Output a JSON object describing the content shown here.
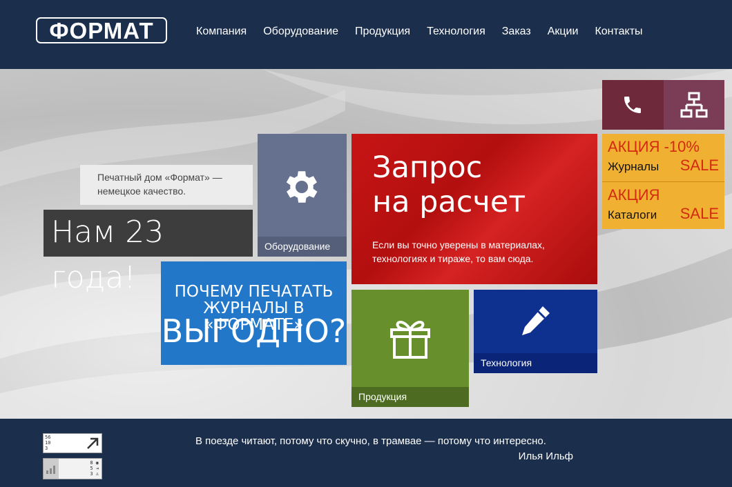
{
  "header": {
    "logo": "ФОРМАТ",
    "nav": [
      "Компания",
      "Оборудование",
      "Продукция",
      "Технология",
      "Заказ",
      "Акции",
      "Контакты"
    ]
  },
  "hero": {
    "tagline": "Печатный дом «Формат» — немецкое качество.",
    "years": "Нам 23 года!"
  },
  "tiles": {
    "equipment": {
      "label": "Оборудование",
      "icon": "gear-icon"
    },
    "request": {
      "title_line1": "Запрос",
      "title_line2": "на расчет",
      "description": "Если вы точно уверены в материалах, технологиях и тираже, то вам сюда."
    },
    "why": {
      "line1": "ПОЧЕМУ ПЕЧАТАТЬ",
      "line2": "ЖУРНАЛЫ В «ФОРМАТЕ»",
      "line3": "ВЫГОДНО?"
    },
    "products": {
      "label": "Продукция",
      "icon": "gift-icon"
    },
    "technology": {
      "label": "Технология",
      "icon": "pencil-icon"
    },
    "phone": {
      "icon": "phone-icon"
    },
    "sitemap": {
      "icon": "sitemap-icon"
    },
    "promos": [
      {
        "title": "АКЦИЯ -10%",
        "name": "Журналы",
        "sale": "SALE"
      },
      {
        "title": "АКЦИЯ",
        "name": "Каталоги",
        "sale": "SALE"
      }
    ]
  },
  "footer": {
    "quote": "В поезде читают, потому что скучно, в трамвае — потому что интересно.",
    "author": "Илья Ильф",
    "counter1": {
      "lines": [
        "56",
        "10",
        "3"
      ]
    },
    "counter2": {
      "lines": [
        "8",
        "5",
        "3"
      ]
    }
  },
  "colors": {
    "header_bg": "#1b2e4c",
    "equipment": "#66718f",
    "request": "#c71515",
    "why": "#2277c9",
    "products": "#67902d",
    "technology": "#0e3190",
    "phone": "#6e2a3a",
    "sitemap": "#7a3d55",
    "promo": "#f0b132",
    "promo_text": "#d32a10"
  }
}
